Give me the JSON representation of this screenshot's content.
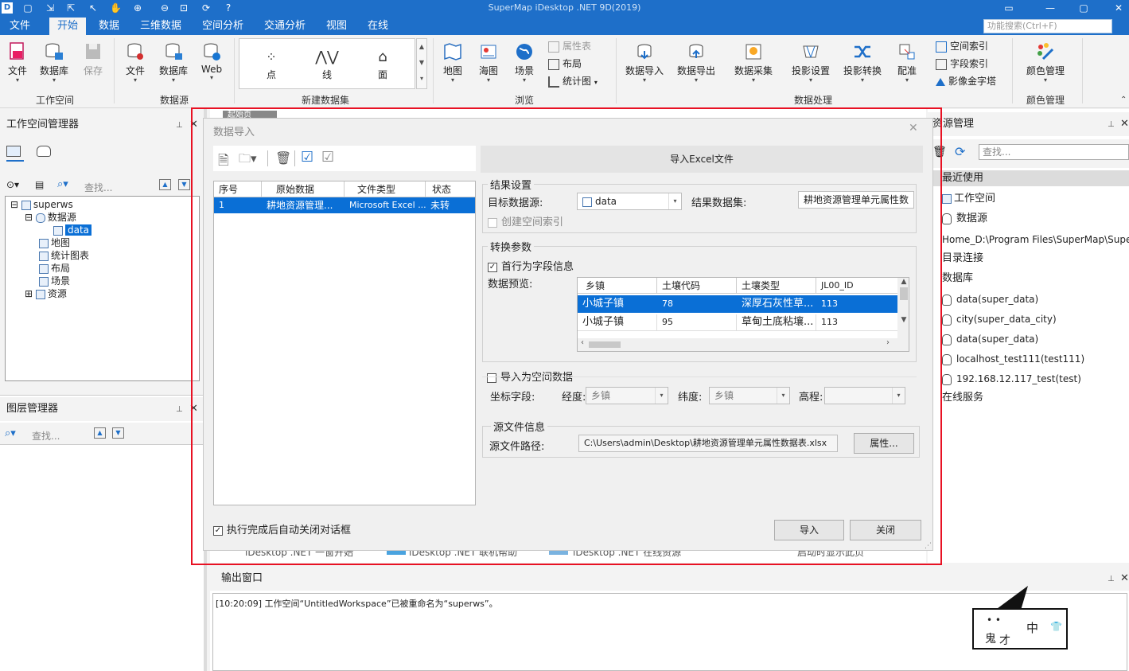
{
  "app": {
    "title": "SuperMap iDesktop .NET 9D(2019)"
  },
  "menu": {
    "items": [
      "文件",
      "开始",
      "数据",
      "三维数据",
      "空间分析",
      "交通分析",
      "视图",
      "在线"
    ],
    "active": "开始",
    "search_placeholder": "功能搜索(Ctrl+F)"
  },
  "ribbon": {
    "workspace": {
      "file": "文件",
      "database": "数据库",
      "save": "保存",
      "group": "工作空间"
    },
    "datasource": {
      "file": "文件",
      "database": "数据库",
      "web": "Web",
      "group": "数据源"
    },
    "new_dataset": {
      "point": "点",
      "line": "线",
      "polygon": "面",
      "group": "新建数据集"
    },
    "browse": {
      "map": "地图",
      "sea_chart": "海图",
      "scene": "场景",
      "attribute_table": "属性表",
      "layout": "布局",
      "stat_chart": "统计图",
      "group": "浏览"
    },
    "data_processing": {
      "import": "数据导入",
      "export": "数据导出",
      "collect": "数据采集",
      "projection_settings": "投影设置",
      "projection_convert": "投影转换",
      "registration": "配准",
      "spatial_index": "空间索引",
      "field_index": "字段索引",
      "image_pyramid": "影像金字塔",
      "group": "数据处理"
    },
    "color": {
      "manage": "颜色管理",
      "group": "颜色管理"
    }
  },
  "workspace_panel": {
    "title": "工作空间管理器",
    "search_placeholder": "查找...",
    "tree": {
      "root": "superws",
      "datasources": "数据源",
      "data": "data",
      "maps": "地图",
      "charts": "统计图表",
      "layouts": "布局",
      "scenes": "场景",
      "resources": "资源"
    }
  },
  "layer_panel": {
    "title": "图层管理器",
    "search_placeholder": "查找..."
  },
  "dialog": {
    "title": "数据导入",
    "list": {
      "headers": [
        "序号",
        "原始数据",
        "文件类型",
        "状态"
      ],
      "rows": [
        {
          "index": "1",
          "source": "耕地资源管理...",
          "type": "Microsoft Excel ...",
          "status": "未转"
        }
      ]
    },
    "section_header": "导入Excel文件",
    "result": {
      "legend": "结果设置",
      "target_label": "目标数据源:",
      "target_value": "data",
      "dataset_label": "结果数据集:",
      "dataset_value": "耕地资源管理单元属性数",
      "spatial_index": "创建空间索引"
    },
    "convert": {
      "legend": "转换参数",
      "first_row": "首行为字段信息",
      "preview_label": "数据预览:",
      "columns": [
        "乡镇",
        "土壤代码",
        "土壤类型",
        "JL00_ID"
      ],
      "rows": [
        [
          "小城子镇",
          "78",
          "深厚石灰性草...",
          "113"
        ],
        [
          "小城子镇",
          "95",
          "草甸土底粘壤...",
          "113"
        ]
      ]
    },
    "spatial": {
      "title": "导入为空间数据",
      "coord_label": "坐标字段:",
      "lon_label": "经度:",
      "lon_value": "乡镇",
      "lat_label": "纬度:",
      "lat_value": "乡镇",
      "elev_label": "高程:",
      "elev_value": ""
    },
    "source": {
      "legend": "源文件信息",
      "path_label": "源文件路径:",
      "path_value": "C:\\Users\\admin\\Desktop\\耕地资源管理单元属性数据表.xlsx",
      "properties": "属性..."
    },
    "auto_close": "执行完成后自动关闭对话框",
    "import_btn": "导入",
    "close_btn": "关闭"
  },
  "startpage": {
    "tab": "起始页",
    "link1": "iDesktop .NET 一窗开始",
    "link2": "iDesktop .NET 联机帮助",
    "link3": "iDesktop .NET 在线资源",
    "auto_show": "启动时显示此页"
  },
  "right_panel": {
    "title": "资源管理",
    "search_placeholder": "查找...",
    "items": {
      "recent": "最近使用",
      "workspace": "工作空间",
      "datasource": "数据源",
      "home": "Home_D:\\Program Files\\SuperMap\\SuperMa...",
      "directory": "目录连接",
      "database": "数据库",
      "db1": "data(super_data)",
      "db2": "city(super_data_city)",
      "db3": "data(super_data)",
      "db4": "localhost_test111(test111)",
      "db5": "192.168.12.117_test(test)",
      "online": "在线服务"
    }
  },
  "output": {
    "title": "输出窗口",
    "log": "[10:20:09] 工作空间“UntitledWorkspace”已被重命名为“superws”。"
  },
  "ime": {
    "name1": "鬼",
    "name2": "才",
    "mode": "中"
  },
  "colors": {
    "accent": "#1e6fc9",
    "selection": "#0a6fd6",
    "highlight": "#e81123"
  }
}
